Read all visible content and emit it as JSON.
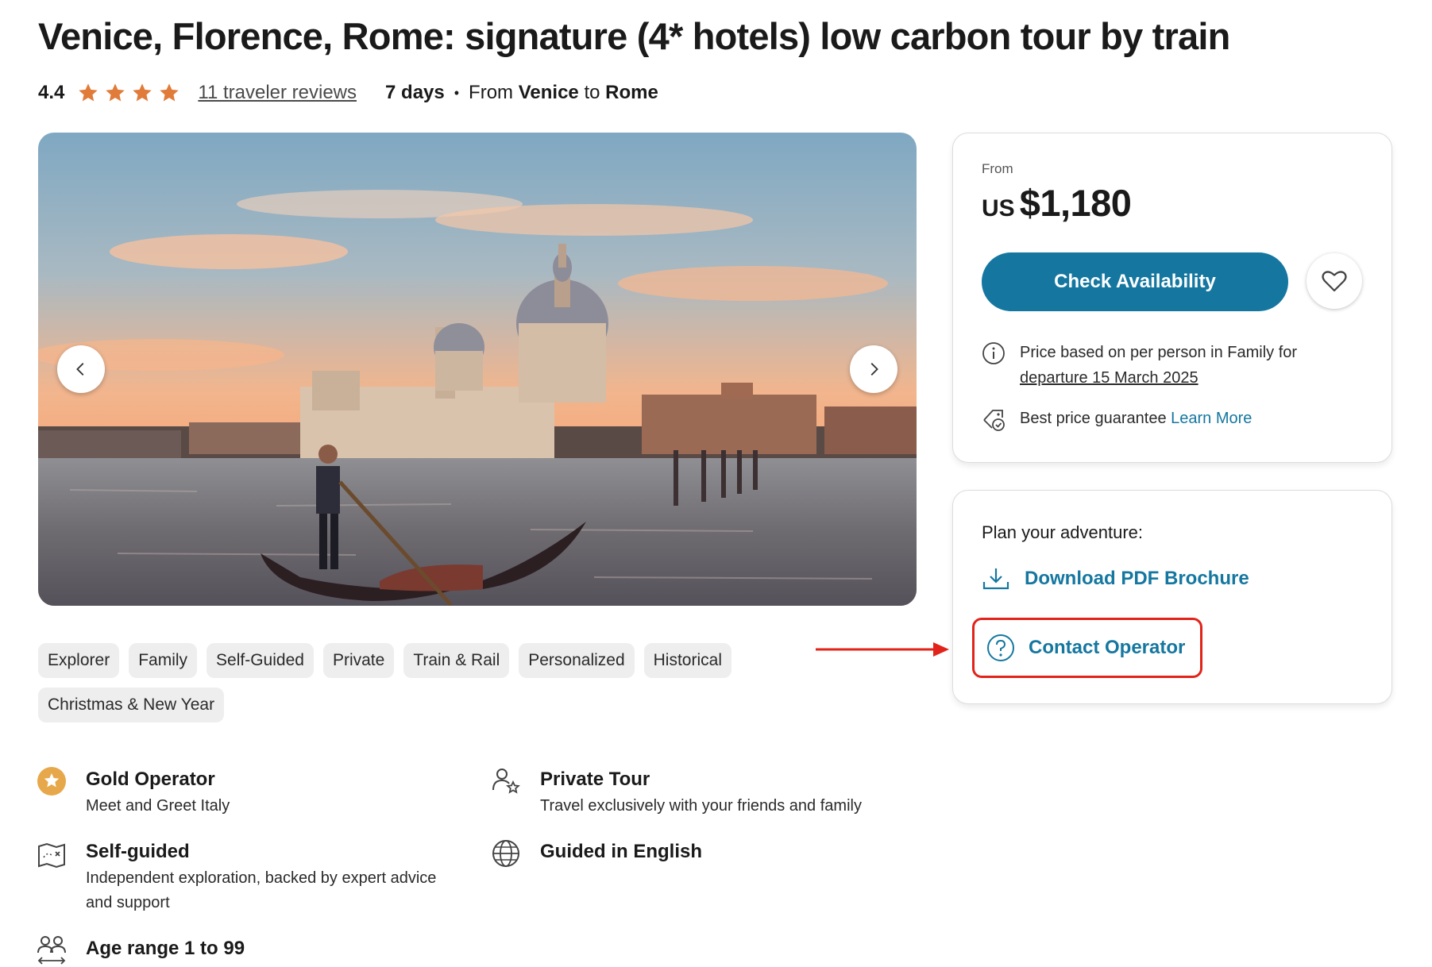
{
  "title": "Venice, Florence, Rome: signature (4* hotels) low carbon tour by train",
  "meta": {
    "rating": "4.4",
    "stars": 4,
    "reviews_link": "11 traveler reviews",
    "duration": "7 days",
    "route_from_word": "From",
    "route_start": "Venice",
    "route_to_word": "to",
    "route_end": "Rome"
  },
  "gallery": {
    "prev_icon": "chevron-left-icon",
    "next_icon": "chevron-right-icon"
  },
  "tags": [
    "Explorer",
    "Family",
    "Self-Guided",
    "Private",
    "Train & Rail",
    "Personalized",
    "Historical",
    "Christmas & New Year"
  ],
  "features": {
    "gold": {
      "title": "Gold Operator",
      "desc": "Meet and Greet Italy",
      "icon": "gold-star-badge-icon"
    },
    "private": {
      "title": "Private Tour",
      "desc": "Travel exclusively with your friends and family",
      "icon": "people-star-icon"
    },
    "selfguided": {
      "title": "Self-guided",
      "desc": "Independent exploration, backed by expert advice and support",
      "icon": "map-icon"
    },
    "language": {
      "title": "Guided in English",
      "icon": "globe-icon"
    },
    "age": {
      "title": "Age range 1 to 99",
      "icon": "age-group-icon"
    }
  },
  "price_card": {
    "from_label": "From",
    "currency": "US",
    "amount": "$1,180",
    "check_button": "Check Availability",
    "wishlist_icon": "heart-icon",
    "info_text": "Price based on per person in Family for",
    "departure": "departure 15 March 2025",
    "guarantee_text": "Best price guarantee",
    "learn_more": "Learn More"
  },
  "plan_card": {
    "title": "Plan your adventure:",
    "download": "Download PDF Brochure",
    "contact": "Contact Operator"
  },
  "colors": {
    "accent": "#1577a0",
    "star": "#e07b39",
    "annotation": "#e2231a"
  }
}
